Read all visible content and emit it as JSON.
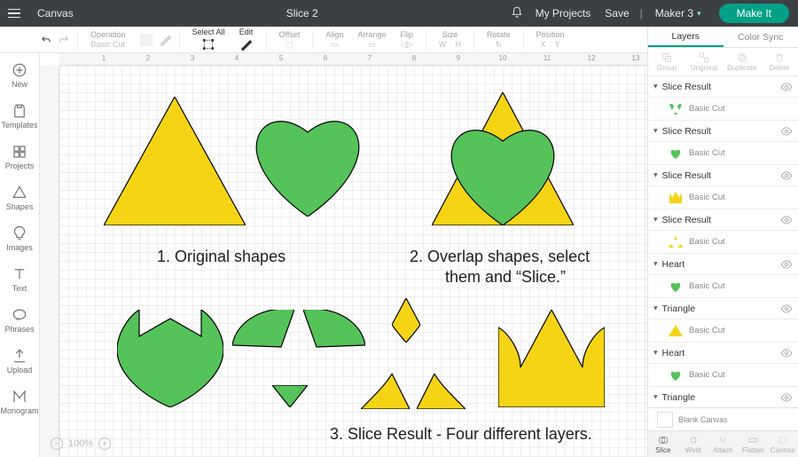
{
  "topbar": {
    "brand": "Canvas",
    "title": "Slice 2",
    "myProjects": "My Projects",
    "save": "Save",
    "machine": "Maker 3",
    "makeIt": "Make It"
  },
  "toolbar": {
    "operation": {
      "label": "Operation",
      "value": "Basic Cut"
    },
    "selectAll": {
      "label": "Select All"
    },
    "edit": {
      "label": "Edit"
    },
    "offset": {
      "label": "Offset"
    },
    "align": {
      "label": "Align"
    },
    "arrange": {
      "label": "Arrange"
    },
    "flip": {
      "label": "Flip"
    },
    "size": {
      "label": "Size",
      "w": "W",
      "h": "H"
    },
    "rotate": {
      "label": "Rotate"
    },
    "position": {
      "label": "Position",
      "x": "X",
      "y": "Y"
    }
  },
  "leftrail": [
    {
      "id": "new",
      "label": "New"
    },
    {
      "id": "templates",
      "label": "Templates"
    },
    {
      "id": "projects",
      "label": "Projects"
    },
    {
      "id": "shapes",
      "label": "Shapes"
    },
    {
      "id": "images",
      "label": "Images"
    },
    {
      "id": "text",
      "label": "Text"
    },
    {
      "id": "phrases",
      "label": "Phrases"
    },
    {
      "id": "upload",
      "label": "Upload"
    },
    {
      "id": "monogram",
      "label": "Monogram"
    }
  ],
  "ruler": {
    "ticks": [
      1,
      2,
      3,
      4,
      5,
      6,
      7,
      8,
      9,
      10,
      11,
      12,
      13
    ]
  },
  "captions": {
    "c1": "1. Original shapes",
    "c2": "2. Overlap shapes, select",
    "c2b": "them and “Slice.”",
    "c3": "3. Slice Result - Four different layers."
  },
  "zoom": {
    "minus": "−",
    "pct": "100%",
    "plus": "+"
  },
  "rpanel": {
    "tabs": {
      "layers": "Layers",
      "colorSync": "Color Sync"
    },
    "actions": {
      "group": "Group",
      "ungroup": "Ungroup",
      "duplicate": "Duplicate",
      "delete": "Delete"
    },
    "basicCut": "Basic Cut",
    "items": [
      {
        "name": "Slice Result",
        "swatch": "slice-green-1"
      },
      {
        "name": "Slice Result",
        "swatch": "heart-green"
      },
      {
        "name": "Slice Result",
        "swatch": "hex-yellow"
      },
      {
        "name": "Slice Result",
        "swatch": "tri-dots"
      },
      {
        "name": "Heart",
        "swatch": "heart-green"
      },
      {
        "name": "Triangle",
        "swatch": "tri-yellow"
      },
      {
        "name": "Heart",
        "swatch": "heart-green"
      },
      {
        "name": "Triangle",
        "swatch": "tri-yellow"
      }
    ],
    "blank": "Blank Canvas",
    "foot": {
      "slice": "Slice",
      "weld": "Weld",
      "attach": "Attach",
      "flatten": "Flatten",
      "contour": "Contour"
    }
  },
  "colors": {
    "green": "#55c25a",
    "yellow": "#f5d416"
  }
}
